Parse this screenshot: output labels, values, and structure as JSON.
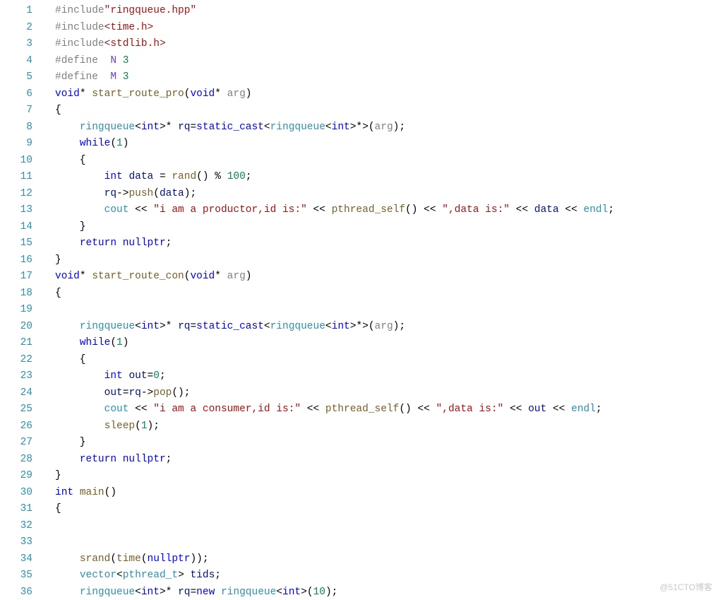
{
  "watermark": "@51CTO博客",
  "code_lines": [
    {
      "n": 1,
      "segs": [
        [
          "pp",
          "#include"
        ],
        [
          "str",
          "\"ringqueue.hpp\""
        ]
      ]
    },
    {
      "n": 2,
      "segs": [
        [
          "pp",
          "#include"
        ],
        [
          "inc",
          "<time.h>"
        ]
      ]
    },
    {
      "n": 3,
      "segs": [
        [
          "pp",
          "#include"
        ],
        [
          "inc",
          "<stdlib.h>"
        ]
      ]
    },
    {
      "n": 4,
      "segs": [
        [
          "pp",
          "#define"
        ],
        [
          "",
          "  "
        ],
        [
          "mac",
          "N"
        ],
        [
          "",
          "",
          " "
        ],
        [
          "num",
          "3"
        ]
      ]
    },
    {
      "n": 5,
      "segs": [
        [
          "pp",
          "#define"
        ],
        [
          "",
          "  "
        ],
        [
          "mac",
          "M"
        ],
        [
          "",
          "",
          " "
        ],
        [
          "num",
          "3"
        ]
      ]
    },
    {
      "n": 6,
      "segs": [
        [
          "kw",
          "void"
        ],
        [
          "",
          "* "
        ],
        [
          "fn",
          "start_route_pro"
        ],
        [
          "",
          "("
        ],
        [
          "kw",
          "void"
        ],
        [
          "",
          "* "
        ],
        [
          "par",
          "arg"
        ],
        [
          "",
          ")"
        ]
      ]
    },
    {
      "n": 7,
      "segs": [
        [
          "",
          "{"
        ]
      ]
    },
    {
      "n": 8,
      "segs": [
        [
          "",
          "    "
        ],
        [
          "type",
          "ringqueue"
        ],
        [
          "",
          "<"
        ],
        [
          "kw",
          "int"
        ],
        [
          "",
          ">* "
        ],
        [
          "dark",
          "rq"
        ],
        [
          "",
          "="
        ],
        [
          "kw",
          "static_cast"
        ],
        [
          "",
          "<"
        ],
        [
          "type",
          "ringqueue"
        ],
        [
          "",
          "<"
        ],
        [
          "kw",
          "int"
        ],
        [
          "",
          ">*>("
        ],
        [
          "par",
          "arg"
        ],
        [
          "",
          ");"
        ]
      ]
    },
    {
      "n": 9,
      "segs": [
        [
          "",
          "    "
        ],
        [
          "kw",
          "while"
        ],
        [
          "",
          "("
        ],
        [
          "num",
          "1"
        ],
        [
          "",
          ")"
        ]
      ]
    },
    {
      "n": 10,
      "segs": [
        [
          "",
          "    {"
        ]
      ]
    },
    {
      "n": 11,
      "segs": [
        [
          "",
          "        "
        ],
        [
          "kw",
          "int"
        ],
        [
          "",
          " "
        ],
        [
          "dark",
          "data"
        ],
        [
          "",
          " = "
        ],
        [
          "fn",
          "rand"
        ],
        [
          "",
          "() % "
        ],
        [
          "num",
          "100"
        ],
        [
          "",
          ";"
        ]
      ]
    },
    {
      "n": 12,
      "segs": [
        [
          "",
          "        "
        ],
        [
          "dark",
          "rq"
        ],
        [
          "",
          "->"
        ],
        [
          "fn",
          "push"
        ],
        [
          "",
          "("
        ],
        [
          "dark",
          "data"
        ],
        [
          "",
          ");"
        ]
      ]
    },
    {
      "n": 13,
      "segs": [
        [
          "",
          "        "
        ],
        [
          "type",
          "cout"
        ],
        [
          "",
          " << "
        ],
        [
          "str",
          "\"i am a productor,id is:\""
        ],
        [
          "",
          " << "
        ],
        [
          "fn",
          "pthread_self"
        ],
        [
          "",
          "() << "
        ],
        [
          "str",
          "\",data is:\""
        ],
        [
          "",
          " << "
        ],
        [
          "dark",
          "data"
        ],
        [
          "",
          " << "
        ],
        [
          "type",
          "endl"
        ],
        [
          "",
          ";"
        ]
      ]
    },
    {
      "n": 14,
      "segs": [
        [
          "",
          "    }"
        ]
      ]
    },
    {
      "n": 15,
      "segs": [
        [
          "",
          "    "
        ],
        [
          "kw",
          "return"
        ],
        [
          "",
          " "
        ],
        [
          "kw",
          "nullptr"
        ],
        [
          "",
          ";"
        ]
      ]
    },
    {
      "n": 16,
      "segs": [
        [
          "",
          "}"
        ]
      ]
    },
    {
      "n": 17,
      "segs": [
        [
          "kw",
          "void"
        ],
        [
          "",
          "* "
        ],
        [
          "fn",
          "start_route_con"
        ],
        [
          "",
          "("
        ],
        [
          "kw",
          "void"
        ],
        [
          "",
          "* "
        ],
        [
          "par",
          "arg"
        ],
        [
          "",
          ")"
        ]
      ]
    },
    {
      "n": 18,
      "segs": [
        [
          "",
          "{"
        ]
      ]
    },
    {
      "n": 19,
      "segs": [
        [
          "",
          ""
        ]
      ]
    },
    {
      "n": 20,
      "segs": [
        [
          "",
          "    "
        ],
        [
          "type",
          "ringqueue"
        ],
        [
          "",
          "<"
        ],
        [
          "kw",
          "int"
        ],
        [
          "",
          ">* "
        ],
        [
          "dark",
          "rq"
        ],
        [
          "",
          "="
        ],
        [
          "kw",
          "static_cast"
        ],
        [
          "",
          "<"
        ],
        [
          "type",
          "ringqueue"
        ],
        [
          "",
          "<"
        ],
        [
          "kw",
          "int"
        ],
        [
          "",
          ">*>("
        ],
        [
          "par",
          "arg"
        ],
        [
          "",
          ");"
        ]
      ]
    },
    {
      "n": 21,
      "segs": [
        [
          "",
          "    "
        ],
        [
          "kw",
          "while"
        ],
        [
          "",
          "("
        ],
        [
          "num",
          "1"
        ],
        [
          "",
          ")"
        ]
      ]
    },
    {
      "n": 22,
      "segs": [
        [
          "",
          "    {"
        ]
      ]
    },
    {
      "n": 23,
      "segs": [
        [
          "",
          "        "
        ],
        [
          "kw",
          "int"
        ],
        [
          "",
          " "
        ],
        [
          "dark",
          "out"
        ],
        [
          "",
          "="
        ],
        [
          "num",
          "0"
        ],
        [
          "",
          ";"
        ]
      ]
    },
    {
      "n": 24,
      "segs": [
        [
          "",
          "        "
        ],
        [
          "dark",
          "out"
        ],
        [
          "",
          "="
        ],
        [
          "dark",
          "rq"
        ],
        [
          "",
          "->"
        ],
        [
          "fn",
          "pop"
        ],
        [
          "",
          "();"
        ]
      ]
    },
    {
      "n": 25,
      "segs": [
        [
          "",
          "        "
        ],
        [
          "type",
          "cout"
        ],
        [
          "",
          " << "
        ],
        [
          "str",
          "\"i am a consumer,id is:\""
        ],
        [
          "",
          " << "
        ],
        [
          "fn",
          "pthread_self"
        ],
        [
          "",
          "() << "
        ],
        [
          "str",
          "\",data is:\""
        ],
        [
          "",
          " << "
        ],
        [
          "dark",
          "out"
        ],
        [
          "",
          " << "
        ],
        [
          "type",
          "endl"
        ],
        [
          "",
          ";"
        ]
      ]
    },
    {
      "n": 26,
      "segs": [
        [
          "",
          "        "
        ],
        [
          "fn",
          "sleep"
        ],
        [
          "",
          "("
        ],
        [
          "num",
          "1"
        ],
        [
          "",
          ");"
        ]
      ]
    },
    {
      "n": 27,
      "segs": [
        [
          "",
          "    }"
        ]
      ]
    },
    {
      "n": 28,
      "segs": [
        [
          "",
          "    "
        ],
        [
          "kw",
          "return"
        ],
        [
          "",
          " "
        ],
        [
          "kw",
          "nullptr"
        ],
        [
          "",
          ";"
        ]
      ]
    },
    {
      "n": 29,
      "segs": [
        [
          "",
          "}"
        ]
      ]
    },
    {
      "n": 30,
      "segs": [
        [
          "kw",
          "int"
        ],
        [
          "",
          " "
        ],
        [
          "fn",
          "main"
        ],
        [
          "",
          "()"
        ]
      ]
    },
    {
      "n": 31,
      "segs": [
        [
          "",
          "{"
        ]
      ]
    },
    {
      "n": 32,
      "segs": [
        [
          "",
          ""
        ]
      ]
    },
    {
      "n": 33,
      "segs": [
        [
          "",
          ""
        ]
      ]
    },
    {
      "n": 34,
      "segs": [
        [
          "",
          "    "
        ],
        [
          "fn",
          "srand"
        ],
        [
          "",
          "("
        ],
        [
          "fn",
          "time"
        ],
        [
          "",
          "("
        ],
        [
          "kw",
          "nullptr"
        ],
        [
          "",
          "));"
        ]
      ]
    },
    {
      "n": 35,
      "segs": [
        [
          "",
          "    "
        ],
        [
          "type",
          "vector"
        ],
        [
          "",
          "<"
        ],
        [
          "type",
          "pthread_t"
        ],
        [
          "",
          "> "
        ],
        [
          "dark",
          "tids"
        ],
        [
          "",
          ";"
        ]
      ]
    },
    {
      "n": 36,
      "segs": [
        [
          "",
          "    "
        ],
        [
          "type",
          "ringqueue"
        ],
        [
          "",
          "<"
        ],
        [
          "kw",
          "int"
        ],
        [
          "",
          ">* "
        ],
        [
          "dark",
          "rq"
        ],
        [
          "",
          "="
        ],
        [
          "kw",
          "new"
        ],
        [
          "",
          " "
        ],
        [
          "type",
          "ringqueue"
        ],
        [
          "",
          "<"
        ],
        [
          "kw",
          "int"
        ],
        [
          "",
          ">("
        ],
        [
          "num",
          "10"
        ],
        [
          "",
          ");"
        ]
      ]
    }
  ]
}
